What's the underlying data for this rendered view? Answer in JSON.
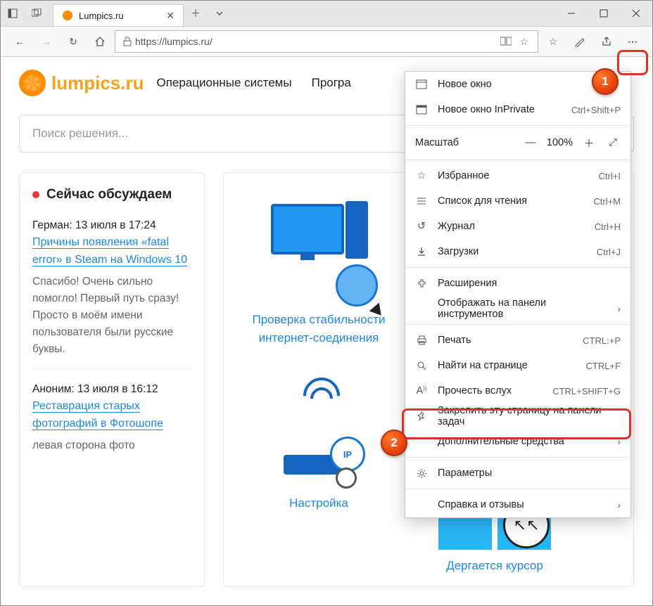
{
  "tab": {
    "title": "Lumpics.ru"
  },
  "url": "https://lumpics.ru/",
  "site": {
    "logo_text": "lumpics.ru",
    "nav": [
      "Операционные системы",
      "Програ"
    ],
    "search_placeholder": "Поиск решения..."
  },
  "sidebar": {
    "title": "Сейчас обсуждаем",
    "items": [
      {
        "meta": "Герман: 13 июля в 17:24",
        "link": "Причины появления «fatal error» в Steam на Windows 10",
        "excerpt": "Спасибо! Очень сильно помогло! Первый путь сразу! Просто в моём имени пользователя были русские буквы."
      },
      {
        "meta": "Аноним: 13 июля в 16:12",
        "link": "Реставрация старых фотографий в Фотошопе",
        "excerpt": "левая сторона фото"
      }
    ]
  },
  "cards": {
    "c0": "Проверка стабильности интернет-соединения",
    "c1": "Настройка",
    "c2": "Дергается курсор"
  },
  "menu": {
    "new_window": "Новое окно",
    "new_inprivate": "Новое окно InPrivate",
    "new_inprivate_key": "Ctrl+Shift+P",
    "zoom_label": "Масштаб",
    "zoom_value": "100%",
    "favorites": "Избранное",
    "favorites_key": "Ctrl+I",
    "reading_list": "Список для чтения",
    "reading_list_key": "Ctrl+M",
    "history": "Журнал",
    "history_key": "Ctrl+H",
    "downloads": "Загрузки",
    "downloads_key": "Ctrl+J",
    "extensions": "Расширения",
    "show_in_toolbar": "Отображать на панели инструментов",
    "print": "Печать",
    "print_key": "CTRL:+P",
    "find": "Найти на странице",
    "find_key": "CTRL+F",
    "read_aloud": "Прочесть вслух",
    "read_aloud_key": "CTRL+SHIFT+G",
    "pin_taskbar": "Закрепить эту страницу на панели задач",
    "more_tools": "Дополнительные средства",
    "settings": "Параметры",
    "feedback": "Справка и отзывы"
  },
  "markers": {
    "m1": "1",
    "m2": "2"
  }
}
